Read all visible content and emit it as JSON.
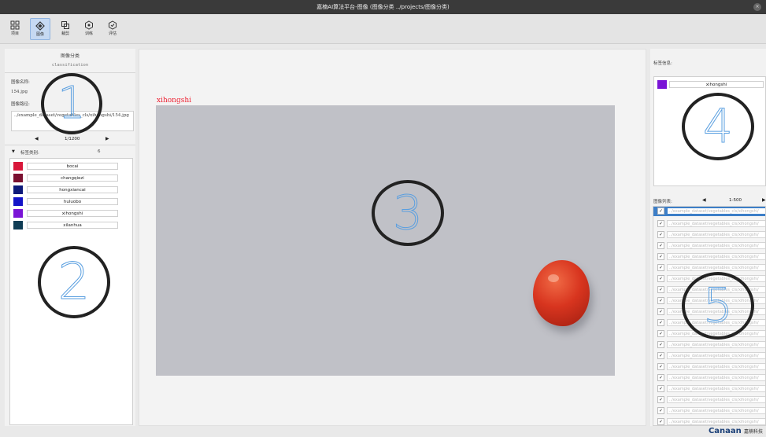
{
  "window": {
    "title": "嘉楠AI算法平台-图像 (图像分类 ../projects/图像分类)",
    "close_glyph": "×"
  },
  "toolbar": {
    "items": [
      {
        "label": "项目",
        "icon": "project-icon"
      },
      {
        "label": "图像",
        "icon": "image-icon"
      },
      {
        "label": "裁剪",
        "icon": "crop-icon"
      },
      {
        "label": "训练",
        "icon": "train-icon"
      },
      {
        "label": "评估",
        "icon": "evaluate-icon"
      }
    ],
    "active_index": 1
  },
  "left_panel": {
    "title_cn": "图像分类",
    "title_en": "classification",
    "image_name_label": "图像名称:",
    "image_name": "154.jpg",
    "image_path_label": "图像路径:",
    "image_path": "../example_dataset/vegetables_cls/xihongshi/154.jpg",
    "nav": {
      "prev": "◀",
      "page": "1/1200",
      "next": "▶"
    },
    "categories_label": "标签类别:",
    "categories_toggle": "▼",
    "categories_count": "6",
    "categories": [
      {
        "name": "bocai",
        "color": "#d8173a"
      },
      {
        "name": "changqiezi",
        "color": "#7a1030"
      },
      {
        "name": "hongxiancai",
        "color": "#0d1a7a"
      },
      {
        "name": "huluobo",
        "color": "#1414c8"
      },
      {
        "name": "xihongshi",
        "color": "#7a14d6"
      },
      {
        "name": "xilanhua",
        "color": "#0f3c55"
      }
    ]
  },
  "center": {
    "image_label": "xihongshi",
    "image_label_color": "#e03030"
  },
  "right_panel": {
    "label_info_title": "标签信息:",
    "current_label": {
      "name": "xihongshi",
      "color": "#7a14d6"
    },
    "file_list_label": "图像列表:",
    "file_nav": {
      "prev": "◀",
      "range": "1-500",
      "next": "▶"
    },
    "files": [
      {
        "checked": "✓",
        "path": "../example_dataset/vegetables_cls/xihongshi/",
        "selected": true
      },
      {
        "checked": "✓",
        "path": "../example_dataset/vegetables_cls/xihongshi/",
        "selected": false
      },
      {
        "checked": "✓",
        "path": "../example_dataset/vegetables_cls/xihongshi/",
        "selected": false
      },
      {
        "checked": "✓",
        "path": "../example_dataset/vegetables_cls/xihongshi/",
        "selected": false
      },
      {
        "checked": "✓",
        "path": "../example_dataset/vegetables_cls/xihongshi/",
        "selected": false
      },
      {
        "checked": "✓",
        "path": "../example_dataset/vegetables_cls/xihongshi/",
        "selected": false
      },
      {
        "checked": "✓",
        "path": "../example_dataset/vegetables_cls/xihongshi/",
        "selected": false
      },
      {
        "checked": "✓",
        "path": "../example_dataset/vegetables_cls/xihongshi/",
        "selected": false
      },
      {
        "checked": "✓",
        "path": "../example_dataset/vegetables_cls/xihongshi/",
        "selected": false
      },
      {
        "checked": "✓",
        "path": "../example_dataset/vegetables_cls/xihongshi/",
        "selected": false
      },
      {
        "checked": "✓",
        "path": "../example_dataset/vegetables_cls/xihongshi/",
        "selected": false
      },
      {
        "checked": "✓",
        "path": "../example_dataset/vegetables_cls/xihongshi/",
        "selected": false
      },
      {
        "checked": "✓",
        "path": "../example_dataset/vegetables_cls/xihongshi/",
        "selected": false
      },
      {
        "checked": "✓",
        "path": "../example_dataset/vegetables_cls/xihongshi/",
        "selected": false
      },
      {
        "checked": "✓",
        "path": "../example_dataset/vegetables_cls/xihongshi/",
        "selected": false
      },
      {
        "checked": "✓",
        "path": "../example_dataset/vegetables_cls/xihongshi/",
        "selected": false
      },
      {
        "checked": "✓",
        "path": "../example_dataset/vegetables_cls/xihongshi/",
        "selected": false
      },
      {
        "checked": "✓",
        "path": "../example_dataset/vegetables_cls/xihongshi/",
        "selected": false
      },
      {
        "checked": "✓",
        "path": "../example_dataset/vegetables_cls/xihongshi/",
        "selected": false
      },
      {
        "checked": "✓",
        "path": "../example_dataset/vegetables_cls/xihongshi/",
        "selected": false
      },
      {
        "checked": "✓",
        "path": "../example_dataset/vegetables_cls/xihongshi/",
        "selected": false
      },
      {
        "checked": "✓",
        "path": "../example_dataset/vegetables_cls/xihongshi/",
        "selected": false
      },
      {
        "checked": "✓",
        "path": "../example_dataset/vegetables_cls/xihongshi/",
        "selected": false
      }
    ]
  },
  "annotations": [
    "1",
    "2",
    "3",
    "4",
    "5"
  ],
  "brand": {
    "logo": "Canaan",
    "text": "嘉楠科技"
  }
}
